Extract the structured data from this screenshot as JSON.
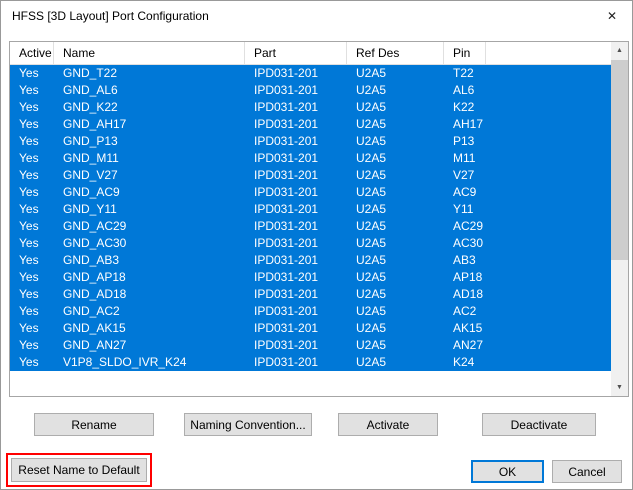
{
  "window": {
    "title": "HFSS [3D Layout] Port Configuration",
    "close_glyph": "✕"
  },
  "colors": {
    "selection_blue": "#0078d7",
    "annotation_red": "#ff0000"
  },
  "table": {
    "columns": [
      "Active",
      "Name",
      "Part",
      "Ref Des",
      "Pin"
    ],
    "rows": [
      {
        "active": "Yes",
        "name": "GND_T22",
        "part": "IPD031-201",
        "ref_des": "U2A5",
        "pin": "T22"
      },
      {
        "active": "Yes",
        "name": "GND_AL6",
        "part": "IPD031-201",
        "ref_des": "U2A5",
        "pin": "AL6"
      },
      {
        "active": "Yes",
        "name": "GND_K22",
        "part": "IPD031-201",
        "ref_des": "U2A5",
        "pin": "K22"
      },
      {
        "active": "Yes",
        "name": "GND_AH17",
        "part": "IPD031-201",
        "ref_des": "U2A5",
        "pin": "AH17"
      },
      {
        "active": "Yes",
        "name": "GND_P13",
        "part": "IPD031-201",
        "ref_des": "U2A5",
        "pin": "P13"
      },
      {
        "active": "Yes",
        "name": "GND_M11",
        "part": "IPD031-201",
        "ref_des": "U2A5",
        "pin": "M11"
      },
      {
        "active": "Yes",
        "name": "GND_V27",
        "part": "IPD031-201",
        "ref_des": "U2A5",
        "pin": "V27"
      },
      {
        "active": "Yes",
        "name": "GND_AC9",
        "part": "IPD031-201",
        "ref_des": "U2A5",
        "pin": "AC9"
      },
      {
        "active": "Yes",
        "name": "GND_Y11",
        "part": "IPD031-201",
        "ref_des": "U2A5",
        "pin": "Y11"
      },
      {
        "active": "Yes",
        "name": "GND_AC29",
        "part": "IPD031-201",
        "ref_des": "U2A5",
        "pin": "AC29"
      },
      {
        "active": "Yes",
        "name": "GND_AC30",
        "part": "IPD031-201",
        "ref_des": "U2A5",
        "pin": "AC30"
      },
      {
        "active": "Yes",
        "name": "GND_AB3",
        "part": "IPD031-201",
        "ref_des": "U2A5",
        "pin": "AB3"
      },
      {
        "active": "Yes",
        "name": "GND_AP18",
        "part": "IPD031-201",
        "ref_des": "U2A5",
        "pin": "AP18"
      },
      {
        "active": "Yes",
        "name": "GND_AD18",
        "part": "IPD031-201",
        "ref_des": "U2A5",
        "pin": "AD18"
      },
      {
        "active": "Yes",
        "name": "GND_AC2",
        "part": "IPD031-201",
        "ref_des": "U2A5",
        "pin": "AC2"
      },
      {
        "active": "Yes",
        "name": "GND_AK15",
        "part": "IPD031-201",
        "ref_des": "U2A5",
        "pin": "AK15"
      },
      {
        "active": "Yes",
        "name": "GND_AN27",
        "part": "IPD031-201",
        "ref_des": "U2A5",
        "pin": "AN27"
      },
      {
        "active": "Yes",
        "name": "V1P8_SLDO_IVR_K24",
        "part": "IPD031-201",
        "ref_des": "U2A5",
        "pin": "K24"
      }
    ]
  },
  "buttons": {
    "rename": "Rename",
    "naming_convention": "Naming Convention...",
    "activate": "Activate",
    "deactivate": "Deactivate",
    "reset_name": "Reset Name to Default",
    "ok": "OK",
    "cancel": "Cancel"
  },
  "scrollbar": {
    "up_glyph": "▲",
    "down_glyph": "▼"
  }
}
